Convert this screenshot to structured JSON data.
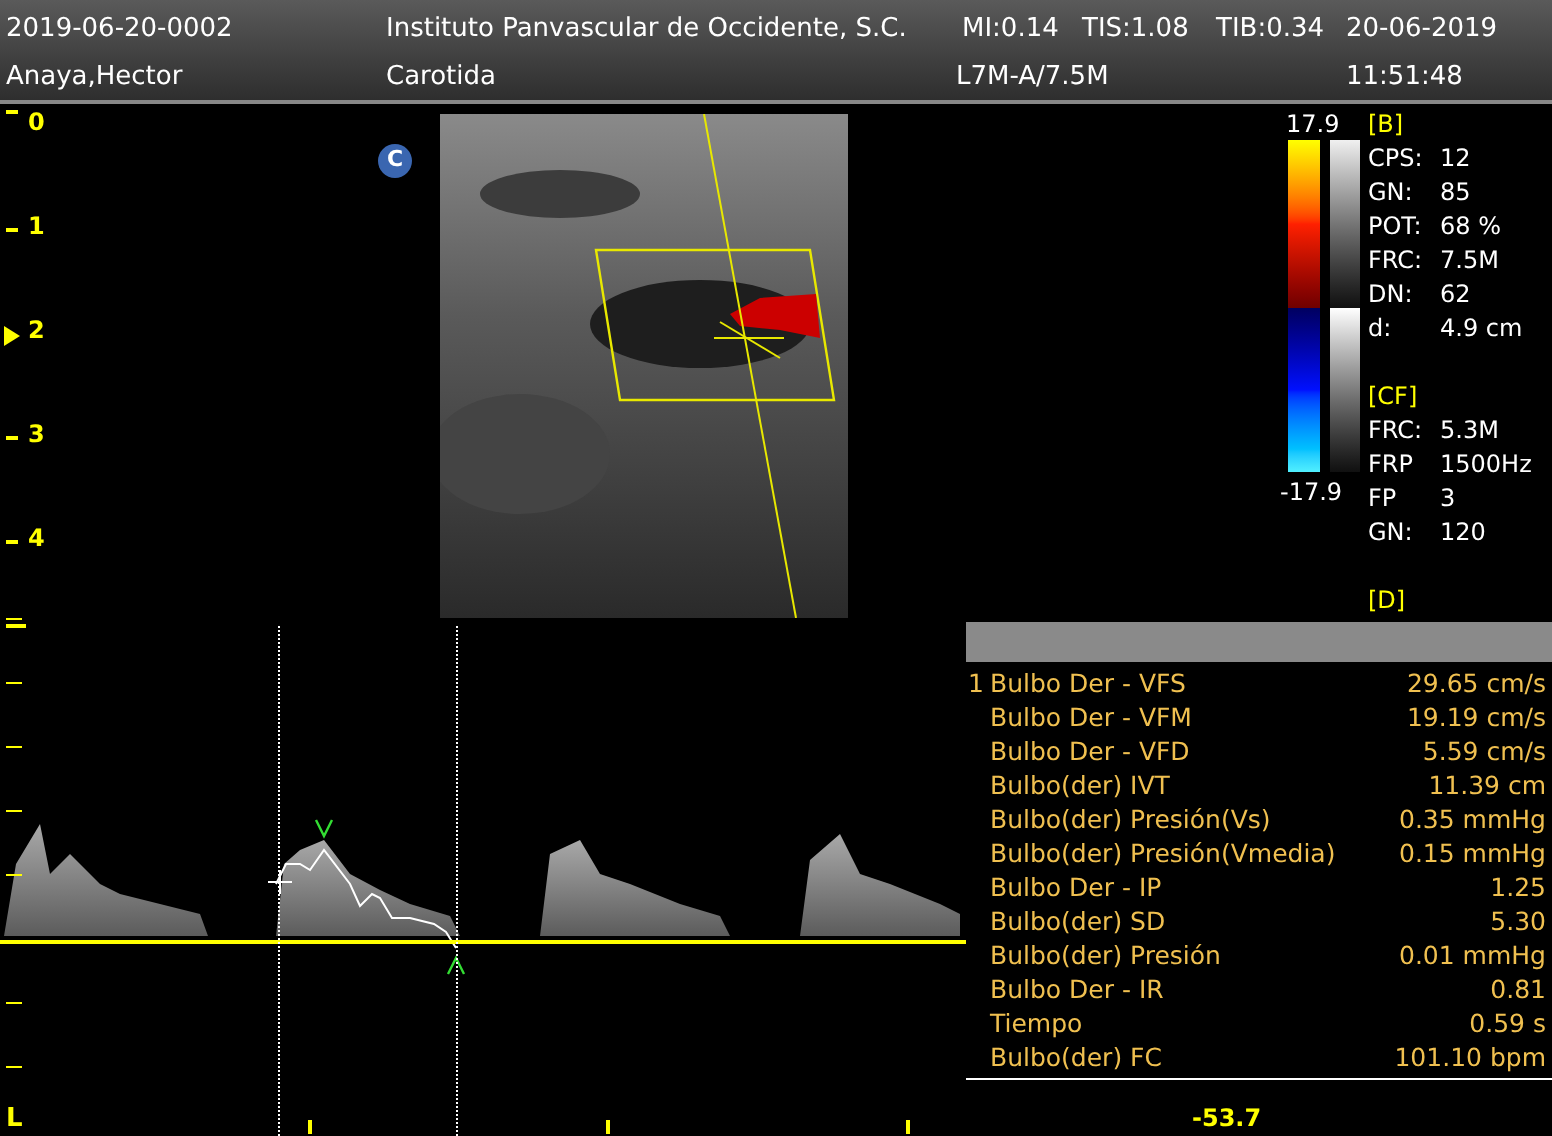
{
  "header": {
    "row_1": [
      "2019-06-20-0002",
      "Instituto Panvascular de Occidente, S.C.",
      "MI:0.14",
      "TIS:1.08",
      "TIB:0.34",
      "20-06-2019"
    ],
    "row_2": [
      "Anaya,Hector",
      "Carotida",
      "L7M-A/7.5M",
      "11:51:48"
    ]
  },
  "depth_scale": [
    {
      "label": "0",
      "selected": false
    },
    {
      "label": "1",
      "selected": false
    },
    {
      "label": "2",
      "selected": true
    },
    {
      "label": "3",
      "selected": false
    },
    {
      "label": "4",
      "selected": false
    }
  ],
  "mode_badge": "C",
  "color_scale": {
    "max": "17.9",
    "min": "-17.9"
  },
  "parameters": [
    {
      "kind": "heading",
      "text": "[B]"
    },
    {
      "kind": "pair",
      "key": "CPS:",
      "value": "12"
    },
    {
      "kind": "pair",
      "key": "GN:",
      "value": "85"
    },
    {
      "kind": "pair",
      "key": "POT:",
      "value": "68 %"
    },
    {
      "kind": "pair",
      "key": "FRC:",
      "value": "7.5M"
    },
    {
      "kind": "pair",
      "key": "DN:",
      "value": "62"
    },
    {
      "kind": "pair",
      "key": "d:",
      "value": "4.9 cm"
    },
    {
      "kind": "gap"
    },
    {
      "kind": "heading",
      "text": "[CF]"
    },
    {
      "kind": "pair",
      "key": "FRC:",
      "value": "5.3M"
    },
    {
      "kind": "pair",
      "key": "FRP",
      "value": "1500Hz"
    },
    {
      "kind": "pair",
      "key": "FP",
      "value": "3"
    },
    {
      "kind": "pair",
      "key": "GN:",
      "value": "120"
    },
    {
      "kind": "gap"
    },
    {
      "kind": "heading",
      "text": "[D]"
    }
  ],
  "measurements": {
    "index": "1",
    "rows": [
      {
        "label": "Bulbo Der - VFS",
        "value": "29.65 cm/s"
      },
      {
        "label": "Bulbo Der - VFM",
        "value": "19.19 cm/s"
      },
      {
        "label": "Bulbo Der - VFD",
        "value": "5.59 cm/s"
      },
      {
        "label": "Bulbo(der) IVT",
        "value": "11.39 cm"
      },
      {
        "label": "Bulbo(der) Presión(Vs)",
        "value": "0.35 mmHg"
      },
      {
        "label": "Bulbo(der) Presión(Vmedia)",
        "value": "0.15 mmHg"
      },
      {
        "label": "Bulbo Der - IP",
        "value": "1.25"
      },
      {
        "label": "Bulbo(der) SD",
        "value": "5.30"
      },
      {
        "label": "Bulbo(der) Presión",
        "value": "0.01 mmHg"
      },
      {
        "label": "Bulbo Der - IR",
        "value": "0.81"
      },
      {
        "label": "Tiempo",
        "value": "0.59 s"
      },
      {
        "label": "Bulbo(der) FC",
        "value": "101.10 bpm"
      }
    ]
  },
  "doppler": {
    "scale_label": "-53.7",
    "baseline_label": "L"
  }
}
